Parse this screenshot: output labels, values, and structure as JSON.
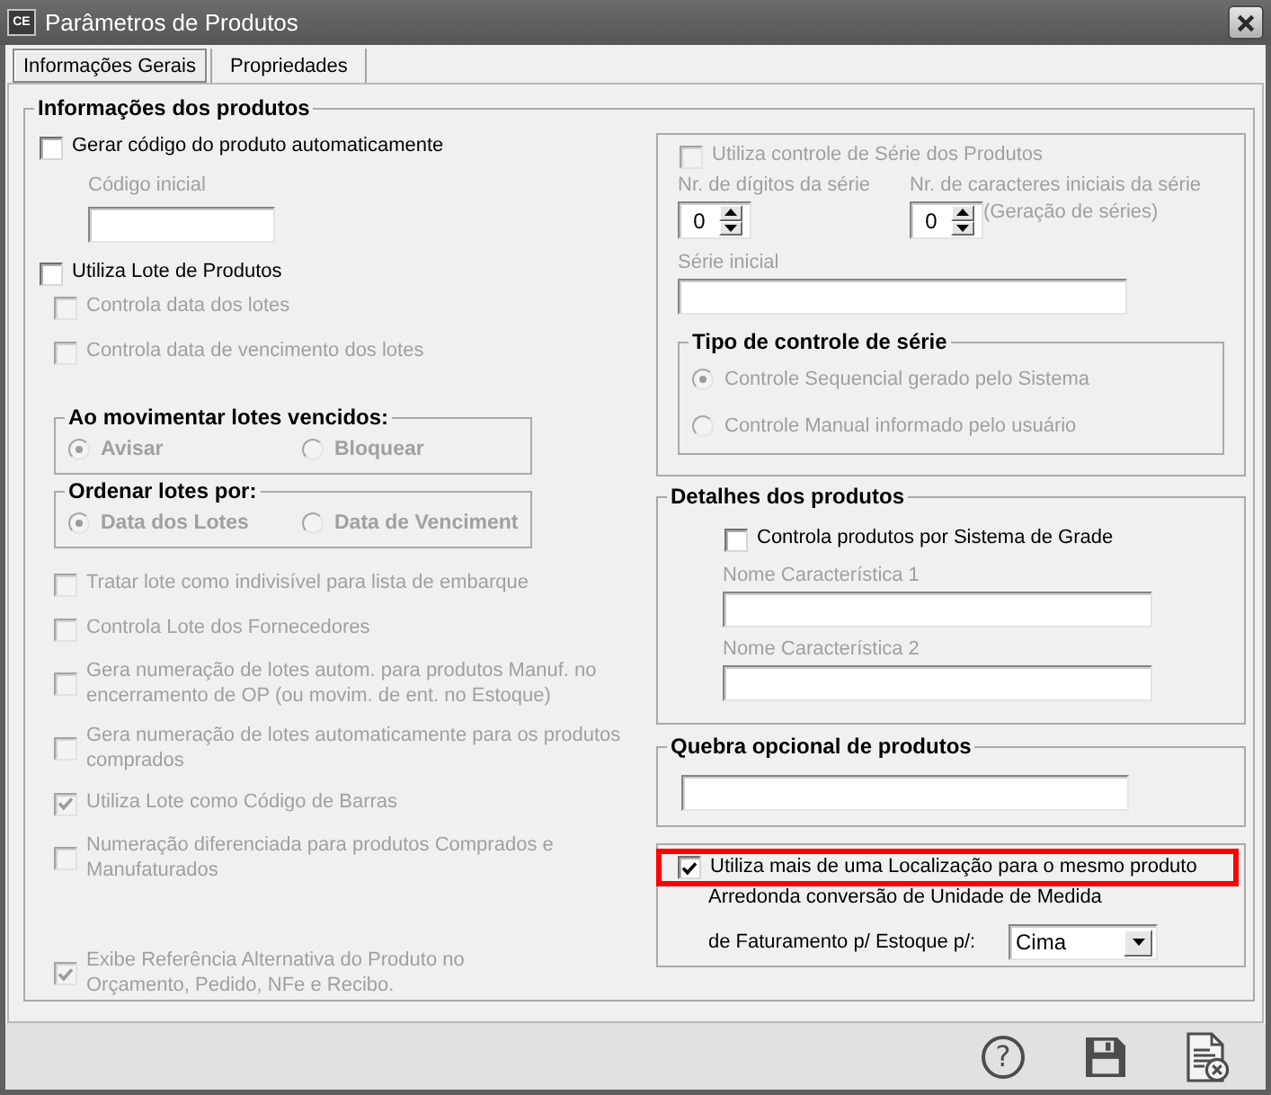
{
  "window": {
    "badge": "CE",
    "title": "Parâmetros de Produtos"
  },
  "tabs": [
    {
      "label": "Informações Gerais",
      "selected": true
    },
    {
      "label": "Propriedades",
      "selected": false
    }
  ],
  "product_info": {
    "title": "Informações dos produtos",
    "left": [
      {
        "kind": "checkbox",
        "label": "Gerar código do produto automaticamente",
        "checked": false,
        "disabled": false
      },
      {
        "kind": "field",
        "label": "Código inicial",
        "disabled": true
      },
      {
        "kind": "checkbox",
        "label": "Utiliza Lote de Produtos",
        "checked": false,
        "disabled": false,
        "children": [
          {
            "kind": "checkbox",
            "label": "Controla data dos lotes",
            "checked": false,
            "disabled": true
          },
          {
            "kind": "checkbox",
            "label": "Controla data de vencimento dos lotes",
            "checked": false,
            "disabled": true
          },
          {
            "kind": "radio_group",
            "title": "Ao movimentar lotes vencidos:",
            "disabled": true,
            "options": [
              {
                "label": "Avisar",
                "selected": true
              },
              {
                "label": "Bloquear",
                "selected": false
              }
            ]
          },
          {
            "kind": "radio_group",
            "title": "Ordenar lotes por:",
            "disabled": true,
            "options": [
              {
                "label": "Data dos Lotes",
                "selected": true
              },
              {
                "label": "Data de Venciment",
                "selected": false
              }
            ]
          },
          {
            "kind": "checkbox",
            "label": "Tratar lote como indivisível para lista de embarque",
            "checked": false,
            "disabled": true
          },
          {
            "kind": "checkbox",
            "label": "Controla Lote dos Fornecedores",
            "checked": false,
            "disabled": true
          },
          {
            "kind": "checkbox",
            "label": "Gera numeração de lotes autom. para produtos Manuf. no\nencerramento de OP (ou movim. de ent. no Estoque)",
            "checked": false,
            "disabled": true
          },
          {
            "kind": "checkbox",
            "label": "Gera numeração de lotes automaticamente para os produtos\ncomprados",
            "checked": false,
            "disabled": true
          },
          {
            "kind": "checkbox",
            "label": "Utiliza Lote como Código de Barras",
            "checked": true,
            "disabled": true
          },
          {
            "kind": "checkbox",
            "label": "Numeração diferenciada para produtos Comprados e\nManufaturados",
            "checked": false,
            "disabled": true
          },
          {
            "kind": "checkbox",
            "label": "Exibe Referência Alternativa do Produto no\nOrçamento, Pedido, NFe e Recibo.",
            "checked": true,
            "disabled": true
          }
        ]
      }
    ],
    "serial": {
      "disabled": true,
      "checkbox": {
        "label": "Utiliza controle de Série dos Produtos",
        "checked": false
      },
      "spinners": [
        {
          "label": "Nr. de dígitos da série",
          "value": "0"
        },
        {
          "label": "Nr. de caracteres iniciais da série",
          "value": "0",
          "note": "(Geração de séries)"
        }
      ],
      "start_field": {
        "label": "Série inicial"
      },
      "type_group": {
        "title": "Tipo de controle de série",
        "options": [
          {
            "label": "Controle Sequencial gerado pelo Sistema",
            "selected": true
          },
          {
            "label": "Controle Manual informado pelo usuário",
            "selected": false
          }
        ]
      }
    },
    "details": {
      "title": "Detalhes dos produtos",
      "checkbox": {
        "label": "Controla produtos por Sistema de Grade",
        "checked": false,
        "disabled": false
      },
      "fields": [
        {
          "label": "Nome Característica 1",
          "disabled": true
        },
        {
          "label": "Nome Característica 2",
          "disabled": true
        }
      ]
    },
    "optional_break": {
      "title": "Quebra opcional de produtos"
    },
    "location": {
      "checkbox": {
        "label": "Utiliza mais de uma Localização para o mesmo produto",
        "checked": true,
        "disabled": false,
        "highlighted": true
      },
      "rounding_caption": "Arredonda conversão de Unidade de Medida",
      "rounding_field": {
        "label": "de Faturamento p/ Estoque p/:",
        "value": "Cima"
      }
    }
  },
  "footer_buttons": [
    {
      "kind": "help",
      "label": "?"
    },
    {
      "kind": "save"
    },
    {
      "kind": "cancel"
    }
  ]
}
